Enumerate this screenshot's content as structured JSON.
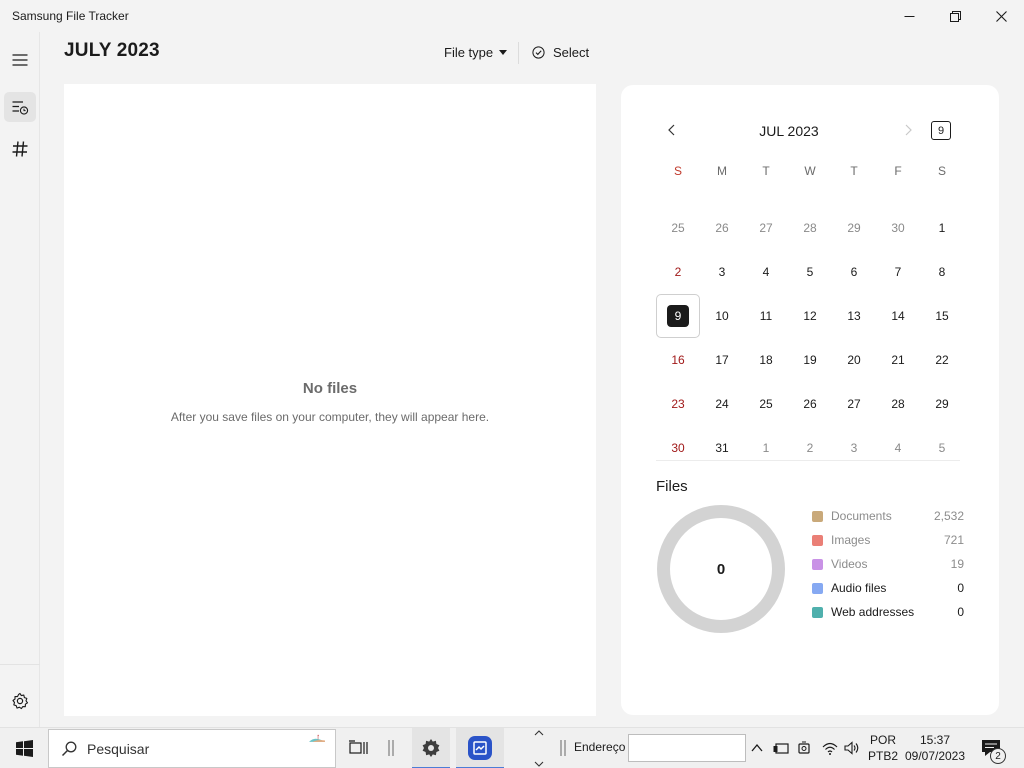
{
  "window": {
    "title": "Samsung File Tracker",
    "icons": {
      "minimize": "minimize-icon",
      "maximize": "restore-icon",
      "close": "close-icon"
    }
  },
  "nav": {
    "items": [
      {
        "name": "menu",
        "icon": "hamburger-icon",
        "active": false
      },
      {
        "name": "timeline",
        "icon": "timeline-icon",
        "active": true
      },
      {
        "name": "tags",
        "icon": "hashtag-icon",
        "active": false
      }
    ],
    "settings_icon": "gear-icon"
  },
  "header": {
    "title": "JULY 2023",
    "file_type_label": "File type",
    "select_label": "Select"
  },
  "files_panel": {
    "empty_title": "No files",
    "empty_message": "After you save files on your computer, they will appear here."
  },
  "calendar": {
    "month_label": "JUL 2023",
    "today_button": "9",
    "weekdays": [
      "S",
      "M",
      "T",
      "W",
      "T",
      "F",
      "S"
    ],
    "weeks": [
      [
        "25",
        "26",
        "27",
        "28",
        "29",
        "30",
        "1"
      ],
      [
        "2",
        "3",
        "4",
        "5",
        "6",
        "7",
        "8"
      ],
      [
        "9",
        "10",
        "11",
        "12",
        "13",
        "14",
        "15"
      ],
      [
        "16",
        "17",
        "18",
        "19",
        "20",
        "21",
        "22"
      ],
      [
        "23",
        "24",
        "25",
        "26",
        "27",
        "28",
        "29"
      ],
      [
        "30",
        "31",
        "1",
        "2",
        "3",
        "4",
        "5"
      ]
    ],
    "selected_date": "9",
    "colors": {
      "sunday": "#a11a1a",
      "weekday_header_sunday": "#c0392b",
      "selected_bg": "#1b1b1b"
    }
  },
  "files_summary": {
    "heading": "Files",
    "total": "0",
    "legend": [
      {
        "label": "Documents",
        "count": "2,532",
        "color": "#c9a97a",
        "dim": true
      },
      {
        "label": "Images",
        "count": "721",
        "color": "#ea7f76",
        "dim": true
      },
      {
        "label": "Videos",
        "count": "19",
        "color": "#c992e6",
        "dim": true
      },
      {
        "label": "Audio files",
        "count": "0",
        "color": "#86a9f2",
        "dim": false
      },
      {
        "label": "Web addresses",
        "count": "0",
        "color": "#4fb0ad",
        "dim": false
      }
    ],
    "donut_color": "#d3d3d3"
  },
  "taskbar": {
    "search_placeholder": "Pesquisar",
    "address_label": "Endereço",
    "language_line1": "POR",
    "language_line2": "PTB2",
    "time": "15:37",
    "date": "09/07/2023",
    "notification_count": "2",
    "accent": "#4c7dd6"
  }
}
